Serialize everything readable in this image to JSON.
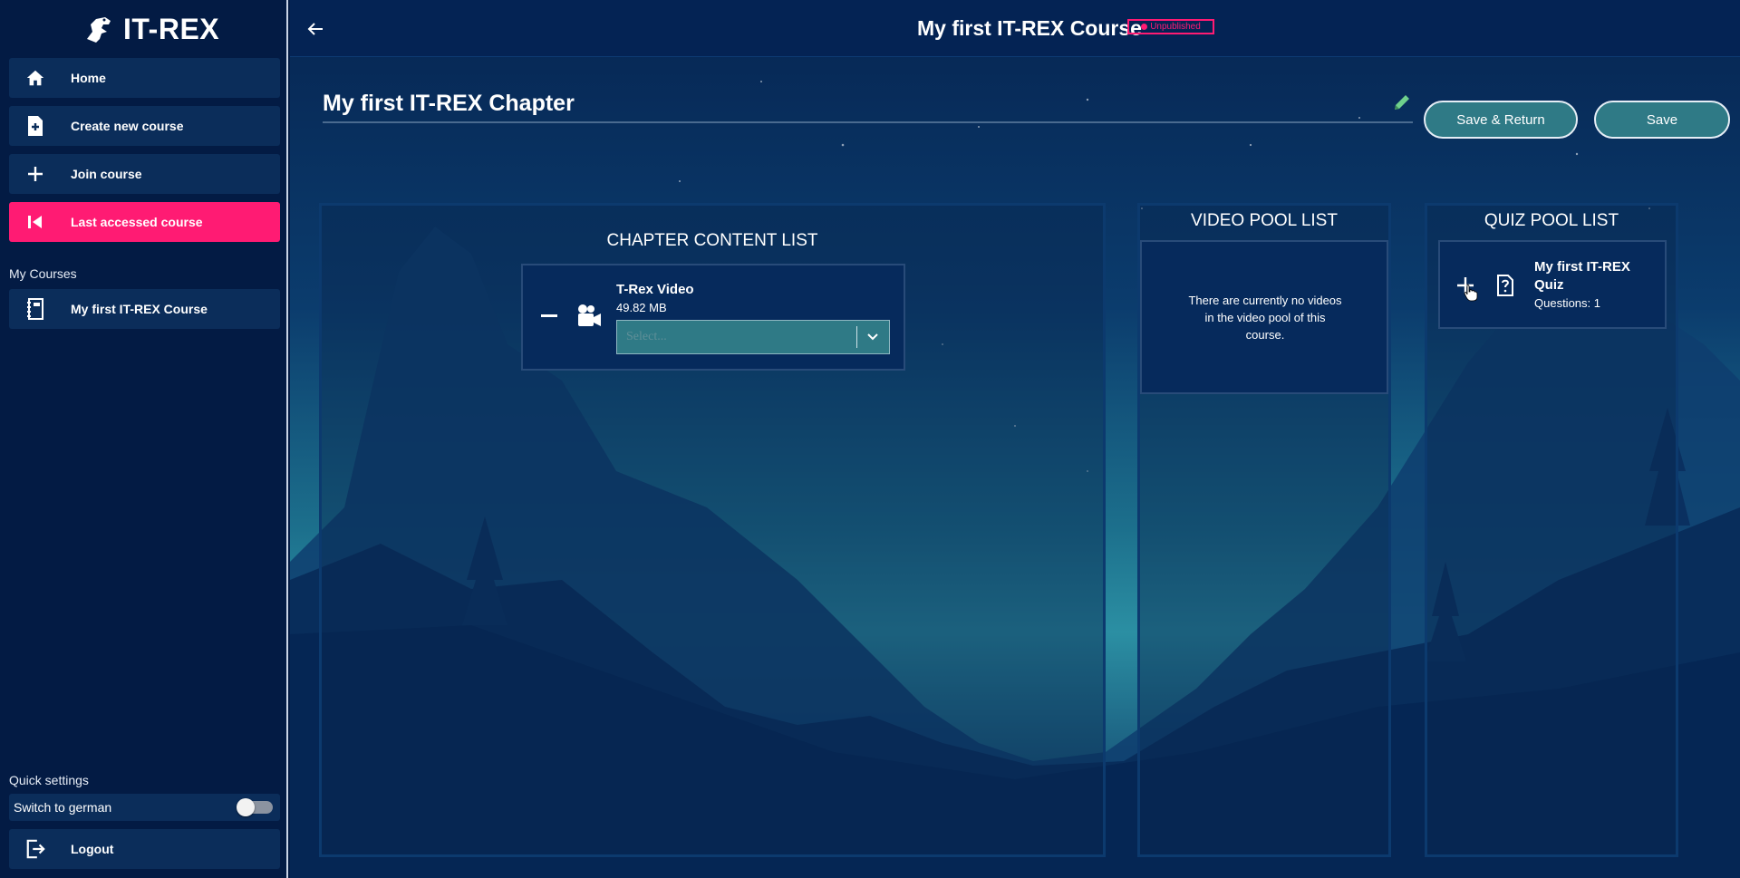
{
  "sidebar": {
    "app_name": "IT-REX",
    "nav": [
      {
        "label": "Home",
        "icon": "home-icon"
      },
      {
        "label": "Create new course",
        "icon": "file-plus-icon"
      },
      {
        "label": "Join course",
        "icon": "plus-icon"
      },
      {
        "label": "Last accessed course",
        "icon": "skip-back-icon"
      }
    ],
    "my_courses_label": "My Courses",
    "courses": [
      {
        "label": "My first IT-REX Course",
        "icon": "notebook-icon"
      }
    ],
    "quick_settings_label": "Quick settings",
    "language_toggle_label": "Switch to german",
    "language_toggle_on": false,
    "logout_label": "Logout"
  },
  "header": {
    "course_title": "My first IT-REX Course",
    "status_badge": "Unpublished"
  },
  "chapter": {
    "title": "My first IT-REX Chapter",
    "save_return_label": "Save & Return",
    "save_label": "Save"
  },
  "chapter_content": {
    "title": "CHAPTER CONTENT LIST",
    "items": [
      {
        "name": "T-Rex Video",
        "size": "49.82 MB",
        "select_placeholder": "Select..."
      }
    ]
  },
  "video_pool": {
    "title": "VIDEO POOL LIST",
    "empty_message": "There are currently no videos in the video pool of this course."
  },
  "quiz_pool": {
    "title": "QUIZ POOL LIST",
    "items": [
      {
        "name": "My first IT-REX Quiz",
        "questions": "Questions: 1"
      }
    ]
  },
  "colors": {
    "accent": "#ff1b73",
    "background": "#031b44",
    "button": "#2f7a86"
  }
}
